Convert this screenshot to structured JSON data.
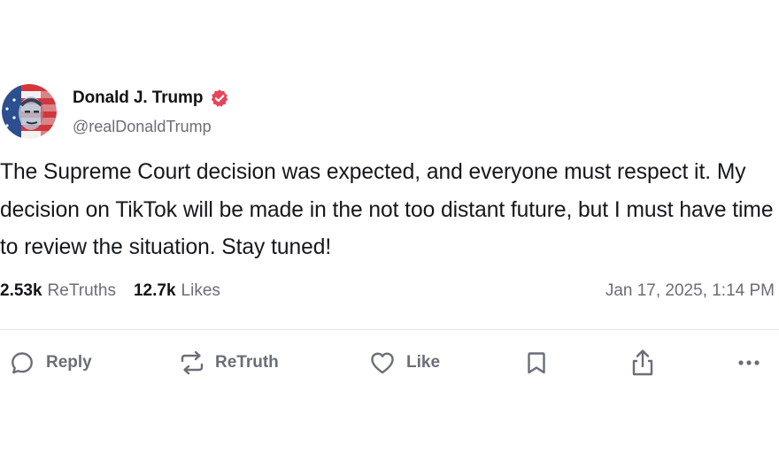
{
  "post": {
    "author": {
      "display_name": "Donald J. Trump",
      "handle": "@realDonaldTrump",
      "verified": true
    },
    "text": "The Supreme Court decision was expected, and everyone must respect it. My decision on TikTok will be made in the not too distant future, but I must have time to review the situation. Stay tuned!",
    "stats": {
      "retruths_count": "2.53k",
      "retruths_label": "ReTruths",
      "likes_count": "12.7k",
      "likes_label": "Likes"
    },
    "timestamp": "Jan 17, 2025, 1:14 PM"
  },
  "actions": {
    "reply_label": "Reply",
    "retruth_label": "ReTruth",
    "like_label": "Like"
  },
  "icons": {
    "verified": "verified-badge-icon",
    "reply": "reply-bubble-icon",
    "retruth": "retruth-arrows-icon",
    "like": "heart-icon",
    "bookmark": "bookmark-icon",
    "share": "share-icon",
    "more": "more-dots-icon"
  },
  "colors": {
    "verified_badge": "#e8445a",
    "text_primary": "#111418",
    "text_secondary": "#6b6e77"
  }
}
